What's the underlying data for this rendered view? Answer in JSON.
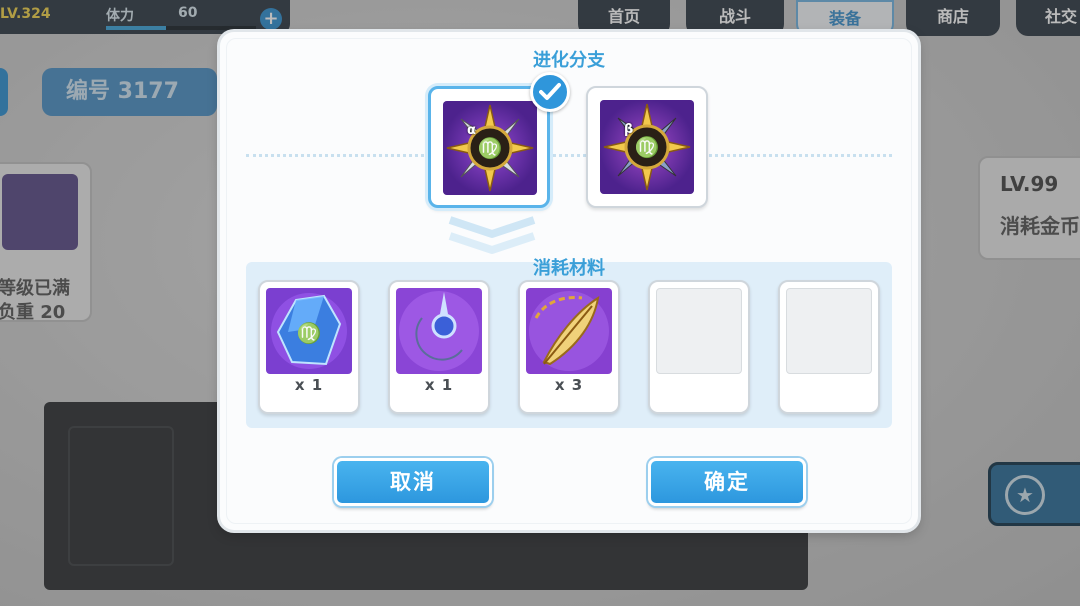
{
  "status": {
    "level": "LV.324",
    "stamina_label": "体力",
    "stamina_value": "60",
    "stamina_fill": 0.4
  },
  "nav": {
    "tabs": [
      "首页",
      "战斗",
      "装备",
      "商店",
      "社交"
    ],
    "active": "装备"
  },
  "background": {
    "serial": "编号 3177",
    "card_text_1": "等级已满",
    "card_text_2": "负重 20",
    "lv_text": "LV.99",
    "consume_gold": "消耗金币"
  },
  "modal": {
    "branch_title": "进化分支",
    "branches": [
      {
        "id": "alpha",
        "symbol": "α",
        "selected": true,
        "icon": "virgo-compass-icon"
      },
      {
        "id": "beta",
        "symbol": "β",
        "selected": false,
        "icon": "virgo-compass-icon"
      }
    ],
    "materials_title": "消耗材料",
    "materials": [
      {
        "icon": "virgo-crystal-icon",
        "qty": "x 1"
      },
      {
        "icon": "crescent-orb-icon",
        "qty": "x 1"
      },
      {
        "icon": "golden-feather-icon",
        "qty": "x 3"
      },
      {
        "icon": "empty-slot",
        "qty": ""
      },
      {
        "icon": "empty-slot",
        "qty": ""
      }
    ],
    "cancel_label": "取消",
    "confirm_label": "确定"
  },
  "colors": {
    "accent": "#2f96db",
    "panel": "#dfeef9",
    "title": "#3a9fd8"
  }
}
